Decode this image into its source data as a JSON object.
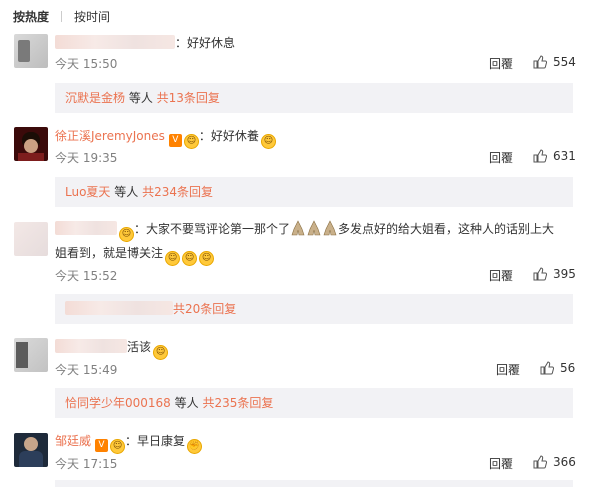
{
  "tabs": [
    "按热度",
    "按时间"
  ],
  "comments": [
    {
      "text": "：好好休息",
      "time": "今天 15:50",
      "reply": "回覆",
      "likes": "554",
      "sub_user": "沉默是金杨",
      "sub_mid": " 等人 ",
      "sub_count": "共13条回复"
    },
    {
      "user": "徐正溪JeremyJones",
      "text": "：好好休養",
      "time": "今天 19:35",
      "reply": "回覆",
      "likes": "631",
      "sub_user": "Luo夏天",
      "sub_mid": " 等人 ",
      "sub_count": "共234条回复"
    },
    {
      "text_a": "：大家不要骂评论第一那个了",
      "text_b": "多发点好的给大姐看，这种人的话别上大",
      "text_c": "姐看到，就是博关注",
      "time": "今天 15:52",
      "reply": "回覆",
      "likes": "395",
      "sub_count": "共20条回复"
    },
    {
      "text": "活该",
      "time": "今天 15:49",
      "reply": "回覆",
      "likes": "56",
      "sub_user": "恰同学少年000168",
      "sub_mid": " 等人 ",
      "sub_count": "共235条回复"
    },
    {
      "user": "邹廷威",
      "text": "：早日康复",
      "time": "今天 17:15",
      "reply": "回覆",
      "likes": "366"
    }
  ],
  "colors": {
    "link": "#eb7350",
    "time": "#808080",
    "subbox_bg": "#f2f2f5"
  },
  "icons": {
    "like": "thumbs-up-icon",
    "vip": "verified-v-badge",
    "emoji": "smile-emoji"
  }
}
